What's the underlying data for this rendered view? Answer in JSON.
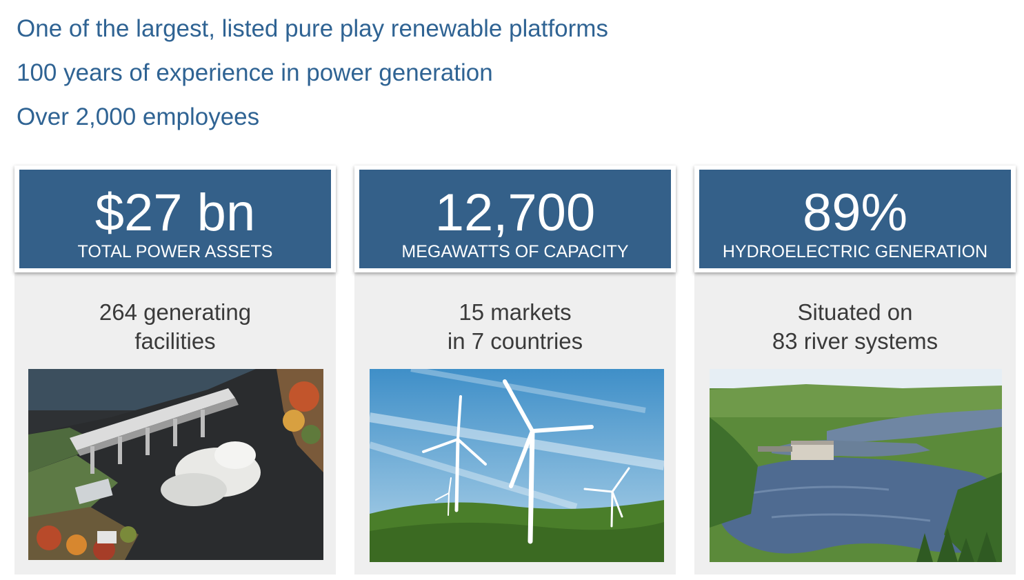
{
  "headlines": [
    "One of the largest, listed pure play renewable platforms",
    "100 years of experience in power generation",
    "Over 2,000 employees"
  ],
  "cards": [
    {
      "value": "$27 bn",
      "label": "TOTAL POWER ASSETS",
      "caption_line1": "264 generating",
      "caption_line2": "facilities",
      "image": "hydro-dam-spillway-photo"
    },
    {
      "value": "12,700",
      "label": "MEGAWATTS OF CAPACITY",
      "caption_line1": "15 markets",
      "caption_line2": "in 7 countries",
      "image": "wind-turbines-photo"
    },
    {
      "value": "89%",
      "label": "HYDROELECTRIC GENERATION",
      "caption_line1": "Situated on",
      "caption_line2": "83 river systems",
      "image": "river-powerhouse-photo"
    }
  ],
  "colors": {
    "headline_text": "#2f6393",
    "stat_box": "#346089",
    "card_background": "#efefef",
    "caption_text": "#3a3a3a"
  }
}
